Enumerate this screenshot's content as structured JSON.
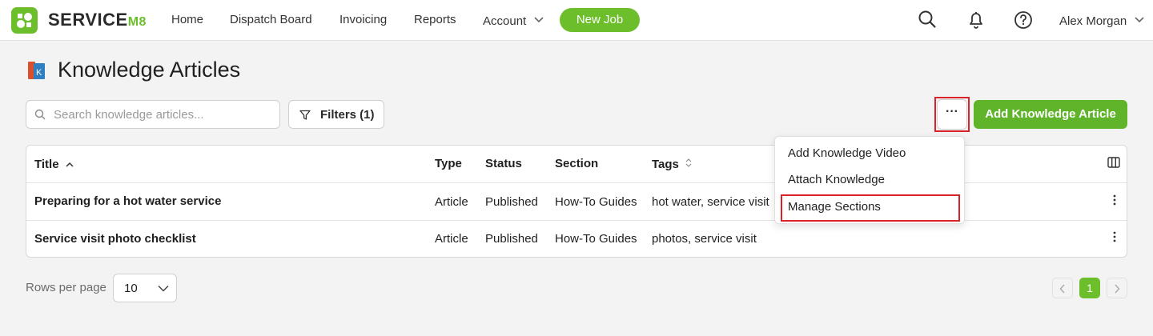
{
  "app": {
    "brand": "SERVICE",
    "brand_suffix": "M8",
    "accent": "#6cbf2b"
  },
  "nav": {
    "items": [
      "Home",
      "Dispatch Board",
      "Invoicing",
      "Reports",
      "Account"
    ],
    "new_job": "New Job",
    "user": "Alex Morgan"
  },
  "page": {
    "title": "Knowledge Articles"
  },
  "toolbar": {
    "search_placeholder": "Search knowledge articles...",
    "filters_label": "Filters (1)",
    "more_label": "···",
    "add_label": "Add Knowledge Article"
  },
  "table": {
    "columns": [
      "Title",
      "Type",
      "Status",
      "Section",
      "Tags"
    ],
    "rows": [
      {
        "title": "Preparing for a hot water service",
        "type": "Article",
        "status": "Published",
        "section": "How-To Guides",
        "tags": "hot water, service visit"
      },
      {
        "title": "Service visit photo checklist",
        "type": "Article",
        "status": "Published",
        "section": "How-To Guides",
        "tags": "photos, service visit"
      }
    ]
  },
  "dropdown": {
    "items": [
      "Add Knowledge Video",
      "Attach Knowledge",
      "Manage Sections"
    ]
  },
  "footer": {
    "rows_label": "Rows per page",
    "rows_value": "10",
    "current_page": "1"
  }
}
